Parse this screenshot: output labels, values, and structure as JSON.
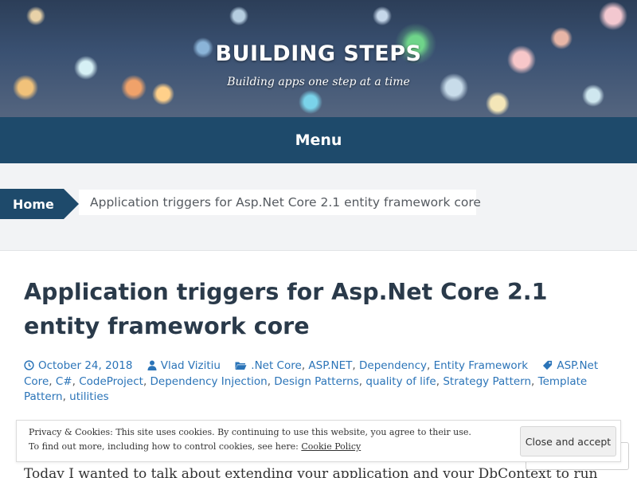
{
  "header": {
    "title": "BUILDING STEPS",
    "tagline": "Building apps one step at a time"
  },
  "menu": {
    "label": "Menu"
  },
  "breadcrumb": {
    "home": "Home",
    "current": "Application triggers for Asp.Net Core 2.1 entity framework core"
  },
  "post": {
    "title": "Application triggers for Asp.Net Core 2.1 entity framework core",
    "date": "October 24, 2018",
    "author": "Vlad Vizitiu",
    "categories": [
      ".Net Core",
      "ASP.NET",
      "Dependency",
      "Entity Framework"
    ],
    "tags": [
      "ASP.Net Core",
      "C#",
      "CodeProject",
      "Dependency Injection",
      "Design Patterns",
      "quality of life",
      "Strategy Pattern",
      "Template Pattern",
      "utilities"
    ],
    "intro": "Today I wanted to talk about extending your application and your DbContext to run"
  },
  "cookie": {
    "line1": "Privacy & Cookies: This site uses cookies. By continuing to use this website, you agree to their use.",
    "line2_prefix": "To find out more, including how to control cookies, see here: ",
    "policy_link": "Cookie Policy",
    "close_button": "Close and accept"
  },
  "colors": {
    "brand_dark_blue": "#1e4a6b",
    "link_blue": "#2b74b8",
    "title_text": "#2a3a4a"
  }
}
